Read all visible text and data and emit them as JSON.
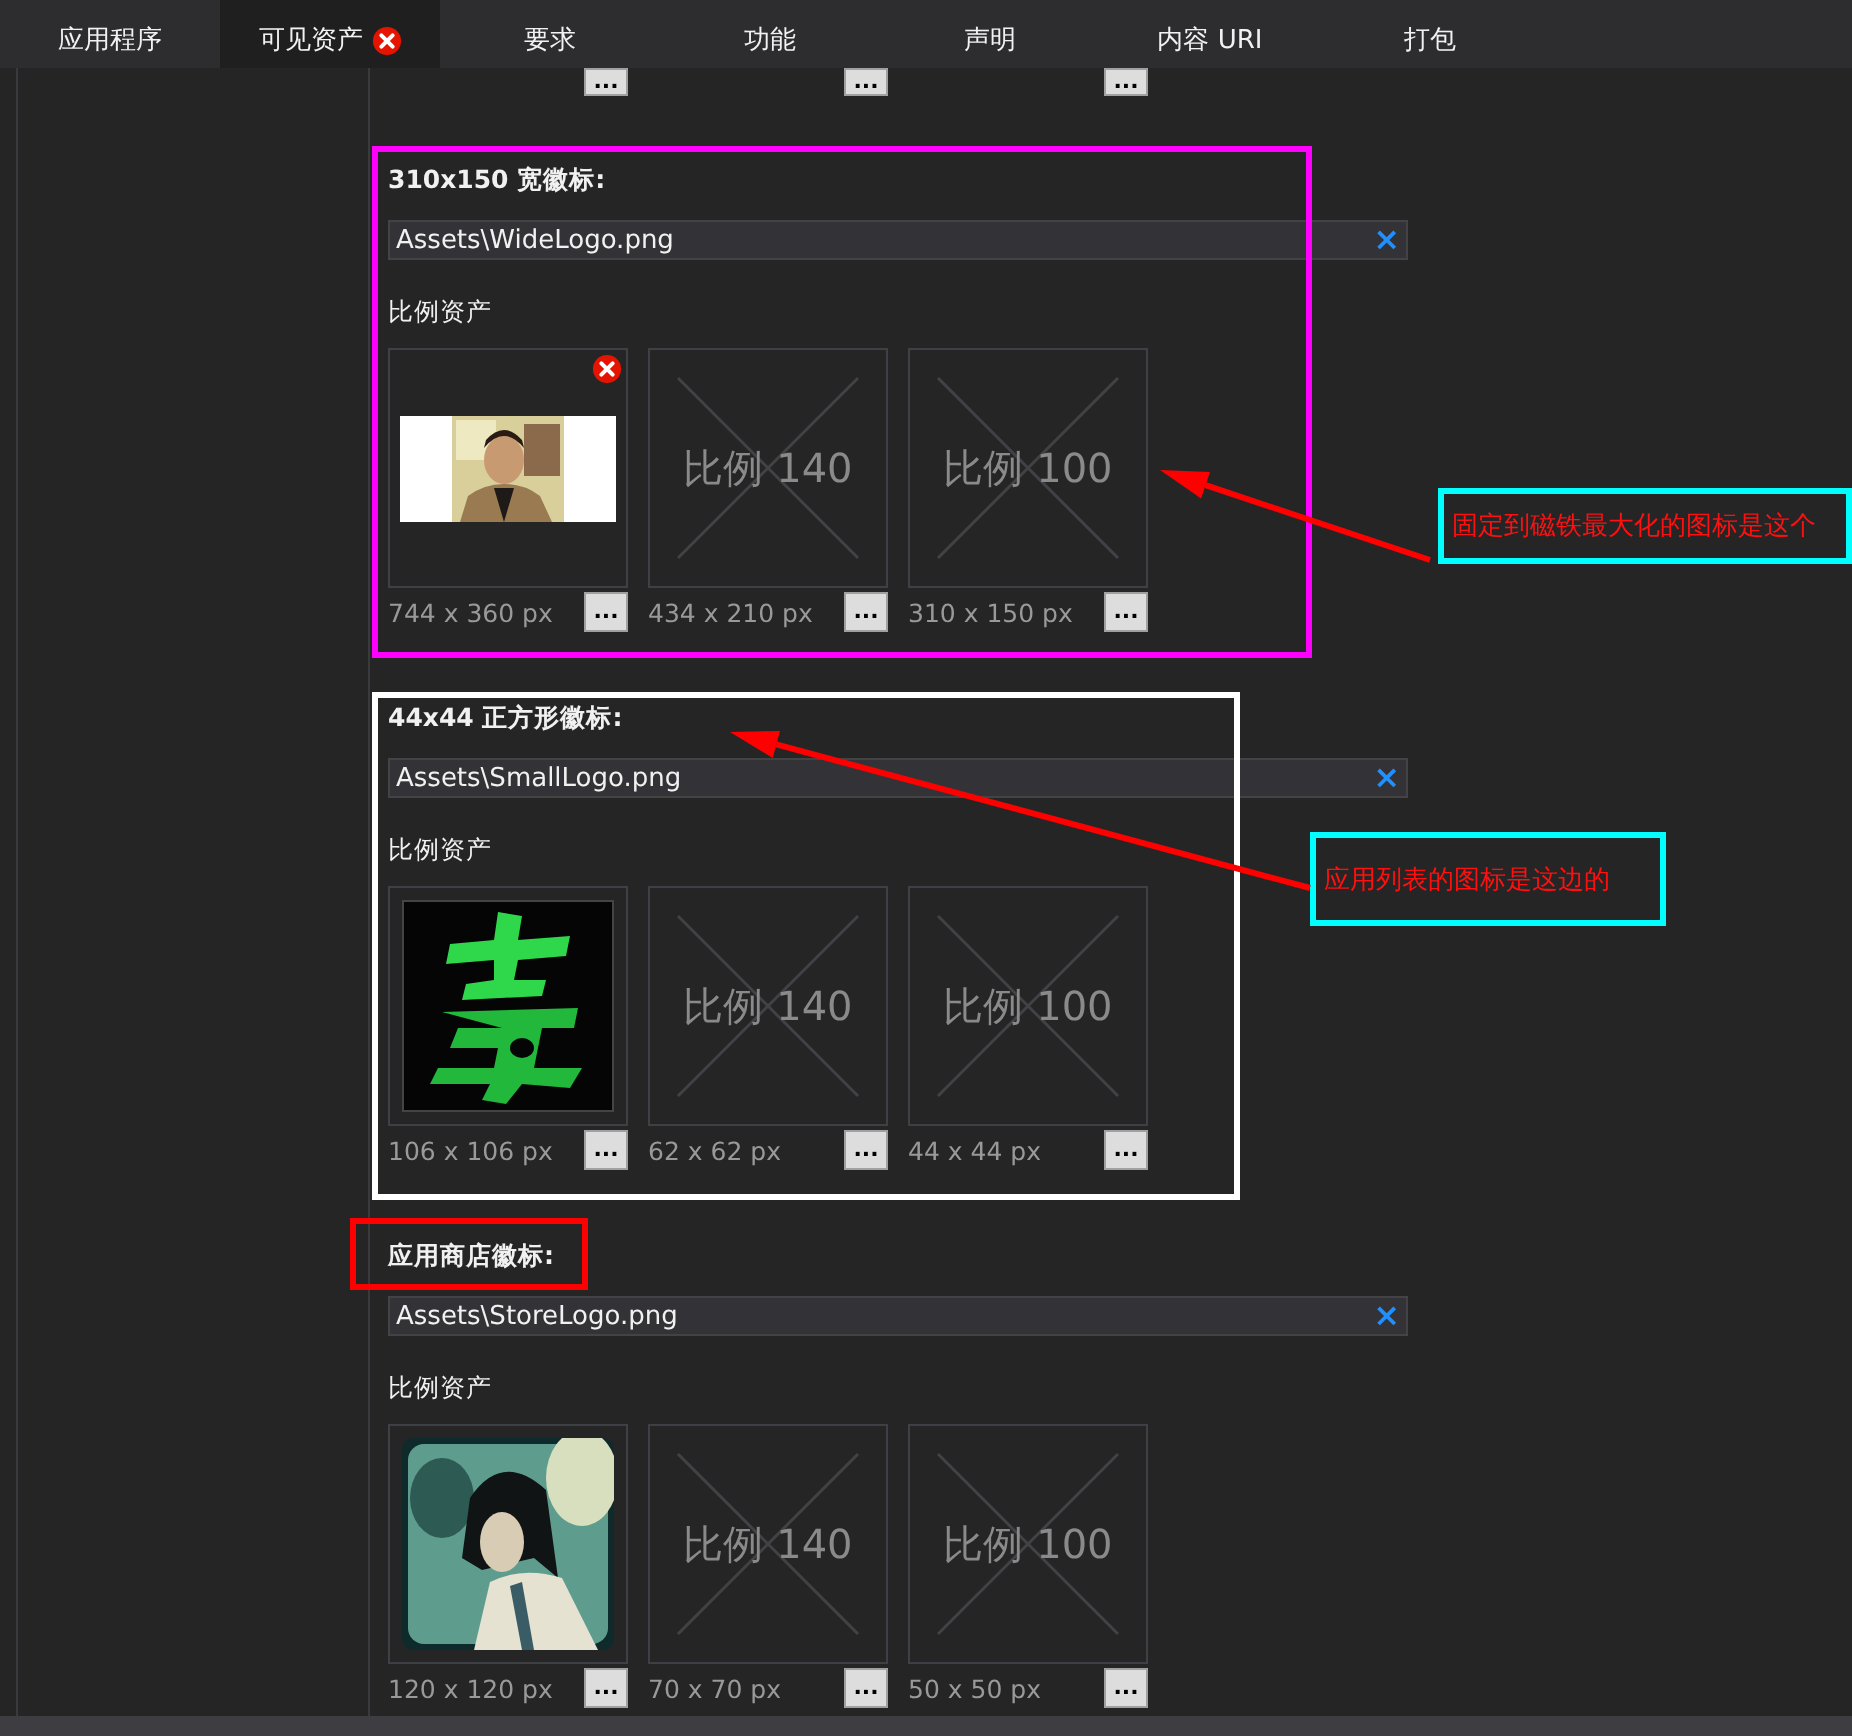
{
  "tabs": [
    {
      "label": "应用程序",
      "selected": false,
      "error": false
    },
    {
      "label": "可见资产",
      "selected": true,
      "error": true
    },
    {
      "label": "要求",
      "selected": false,
      "error": false
    },
    {
      "label": "功能",
      "selected": false,
      "error": false
    },
    {
      "label": "声明",
      "selected": false,
      "error": false
    },
    {
      "label": "内容 URI",
      "selected": false,
      "error": false
    },
    {
      "label": "打包",
      "selected": false,
      "error": false
    }
  ],
  "partial_row": {
    "buttons": [
      "...",
      "...",
      "..."
    ]
  },
  "sections": [
    {
      "title": "310x150 宽徽标:",
      "path": "Assets\\WideLogo.png",
      "clear": "×",
      "scaled_label": "比例资产",
      "assets": [
        {
          "kind": "picture",
          "size": "744 x 360 px",
          "button": "...",
          "error": true
        },
        {
          "kind": "placeholder",
          "text": "比例 140",
          "size": "434 x 210 px",
          "button": "...",
          "error": false
        },
        {
          "kind": "placeholder",
          "text": "比例 100",
          "size": "310 x 150 px",
          "button": "...",
          "error": false
        }
      ]
    },
    {
      "title": "44x44 正方形徽标:",
      "path": "Assets\\SmallLogo.png",
      "clear": "×",
      "scaled_label": "比例资产",
      "assets": [
        {
          "kind": "picture",
          "size": "106 x 106 px",
          "button": "...",
          "error": false
        },
        {
          "kind": "placeholder",
          "text": "比例 140",
          "size": "62 x 62 px",
          "button": "...",
          "error": false
        },
        {
          "kind": "placeholder",
          "text": "比例 100",
          "size": "44 x 44 px",
          "button": "...",
          "error": false
        }
      ]
    },
    {
      "title": "应用商店徽标:",
      "path": "Assets\\StoreLogo.png",
      "clear": "×",
      "scaled_label": "比例资产",
      "assets": [
        {
          "kind": "picture",
          "size": "120 x 120 px",
          "button": "...",
          "error": false
        },
        {
          "kind": "placeholder",
          "text": "比例 140",
          "size": "70 x 70 px",
          "button": "...",
          "error": false
        },
        {
          "kind": "placeholder",
          "text": "比例 100",
          "size": "50 x 50 px",
          "button": "...",
          "error": false
        }
      ]
    }
  ],
  "annotations": [
    {
      "kind": "frame",
      "color": "#ff00ff"
    },
    {
      "kind": "frame",
      "color": "#ffffff"
    },
    {
      "kind": "frame",
      "color": "#ff0000"
    },
    {
      "kind": "callout",
      "text": "固定到磁铁最大化的图标是这个"
    },
    {
      "kind": "callout",
      "text": "应用列表的图标是这边的"
    },
    {
      "kind": "arrow"
    },
    {
      "kind": "arrow"
    }
  ]
}
